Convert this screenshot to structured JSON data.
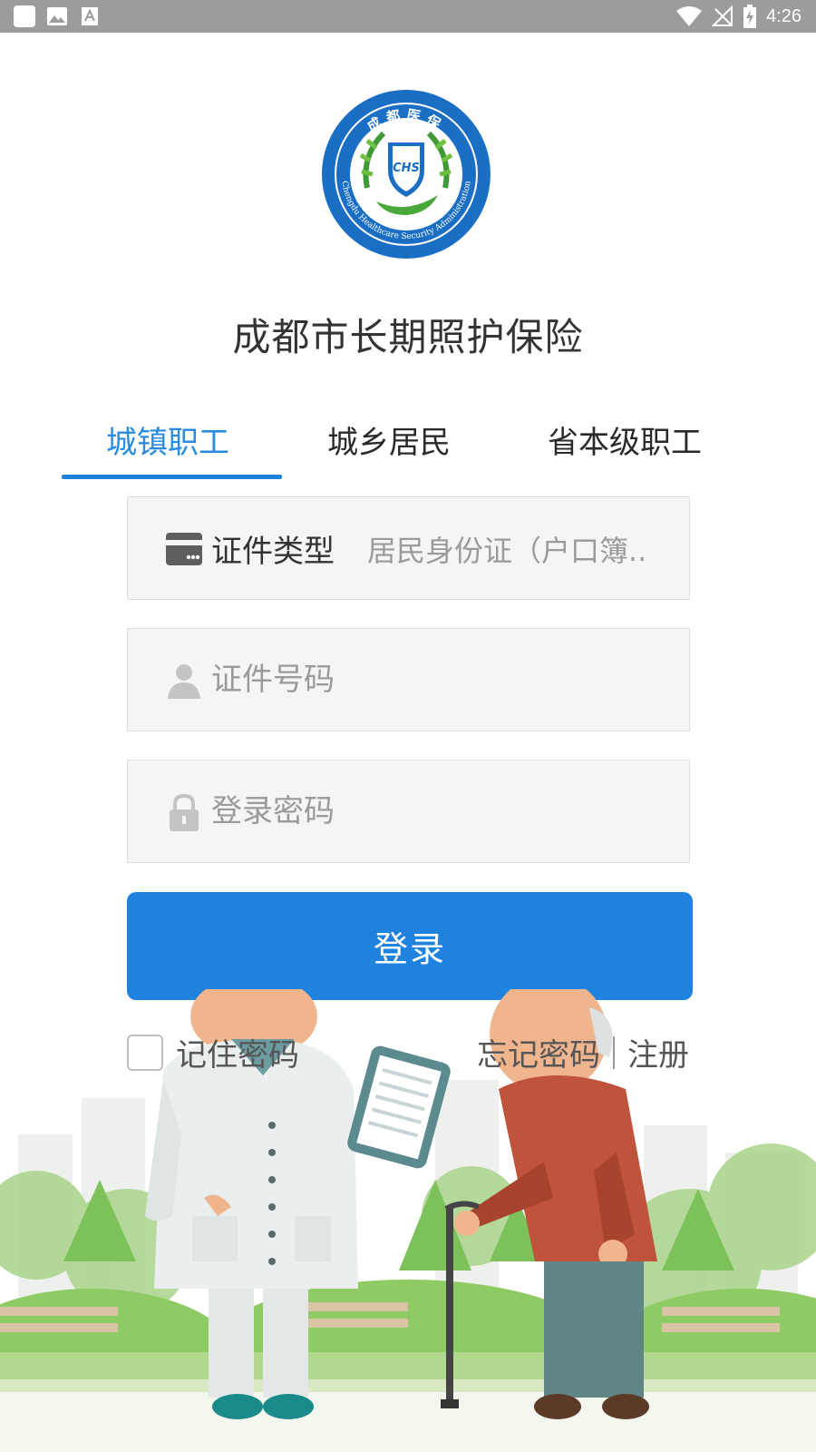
{
  "status_bar": {
    "time": "4:26",
    "left_icons": [
      "app-notification-icon",
      "image-icon",
      "text-icon"
    ],
    "right_icons": [
      "wifi-icon",
      "no-signal-icon",
      "battery-charging-icon"
    ]
  },
  "logo": {
    "arc_text_top": "成都医保",
    "arc_text_bottom": "Chengdu Healthcare Security Administration",
    "shield_text": "CHS"
  },
  "app_title": "成都市长期照护保险",
  "tabs": [
    {
      "label": "城镇职工",
      "active": true
    },
    {
      "label": "城乡居民",
      "active": false
    },
    {
      "label": "省本级职工",
      "active": false
    }
  ],
  "form": {
    "id_type": {
      "label": "证件类型",
      "value": "居民身份证（户口簿.."
    },
    "id_number": {
      "placeholder": "证件号码",
      "value": ""
    },
    "password": {
      "placeholder": "登录密码",
      "value": ""
    }
  },
  "login_button": "登录",
  "remember_password": {
    "label": "记住密码",
    "checked": false
  },
  "forgot_password": "忘记密码",
  "register": "注册",
  "colors": {
    "accent": "#1e82de",
    "active_tab": "#2a8be0",
    "field_bg": "#f5f5f5",
    "status_bar": "#9c9c9c"
  }
}
